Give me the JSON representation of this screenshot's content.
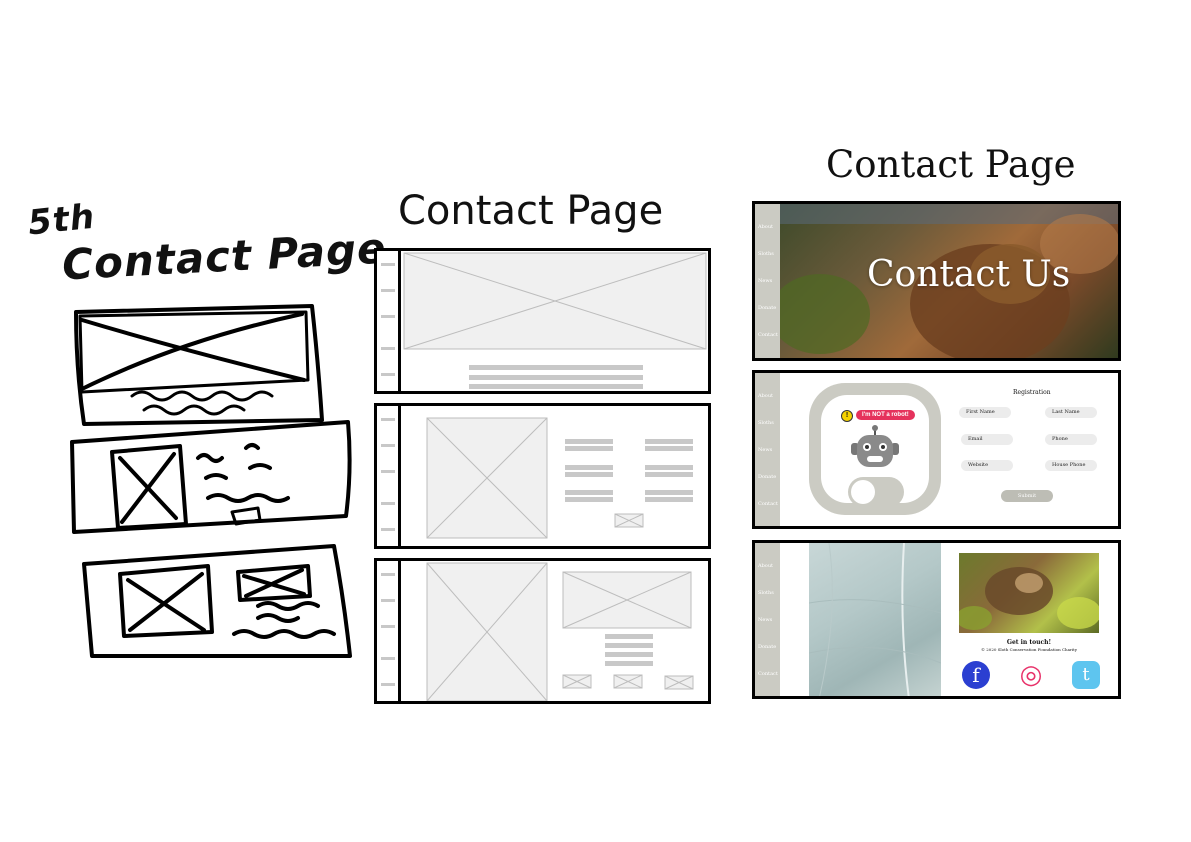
{
  "handwritten": {
    "title_line1": "5th",
    "title_line2": "Contact Page"
  },
  "wireframe": {
    "title": "Contact Page"
  },
  "final": {
    "title": "Contact Page",
    "nav_items": [
      "About",
      "Sloths",
      "News",
      "Donate",
      "Contact"
    ],
    "hero": {
      "heading": "Contact Us"
    },
    "registration": {
      "title": "Registration",
      "bubble": "I'm NOT a robot!",
      "warn_glyph": "!",
      "fields": [
        "First Name",
        "Last Name",
        "Email",
        "Phone",
        "Website",
        "House Phone"
      ],
      "submit_label": "Submit"
    },
    "footer": {
      "heading": "Get in touch!",
      "copyright": "© 2020 Sloth Conservation Foundation Charity",
      "social": [
        {
          "name": "facebook",
          "glyph": "f",
          "color": "#2b3fd1"
        },
        {
          "name": "instagram",
          "glyph": "◎",
          "color": "#e8326a"
        },
        {
          "name": "tumblr",
          "glyph": "t",
          "color": "#5ec5ef"
        }
      ]
    },
    "colors": {
      "sidebar": "#cbcbc3",
      "bubble": "#e5325c",
      "facebook": "#2b3fd1",
      "instagram": "#e8326a",
      "tumblr": "#5ec5ef"
    }
  }
}
